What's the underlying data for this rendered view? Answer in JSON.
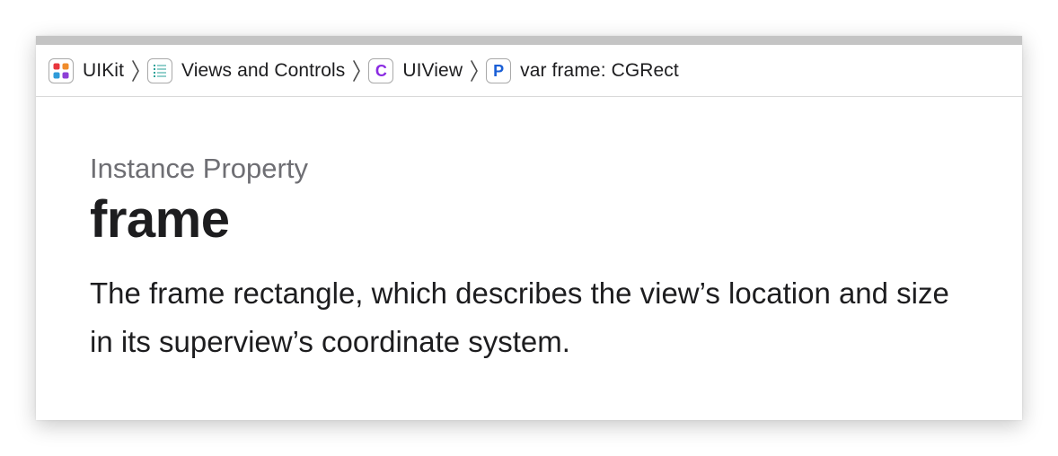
{
  "breadcrumb": {
    "items": [
      {
        "label": "UIKit",
        "icon": "framework-icon"
      },
      {
        "label": "Views and Controls",
        "icon": "collection-list-icon"
      },
      {
        "label": "UIView",
        "icon": "class-icon",
        "icon_letter": "C",
        "icon_color": "#8a2be2"
      },
      {
        "label": "var frame: CGRect",
        "icon": "property-icon",
        "icon_letter": "P",
        "icon_color": "#1a5fd6"
      }
    ]
  },
  "doc": {
    "eyebrow": "Instance Property",
    "title": "frame",
    "abstract": "The frame rectangle, which describes the view’s location and size in its superview’s coordinate system."
  },
  "colors": {
    "framework_dots": [
      "#e8363d",
      "#f08c2b",
      "#2f9bd9",
      "#8e3fd6"
    ],
    "list_icon": "#2aa198"
  }
}
